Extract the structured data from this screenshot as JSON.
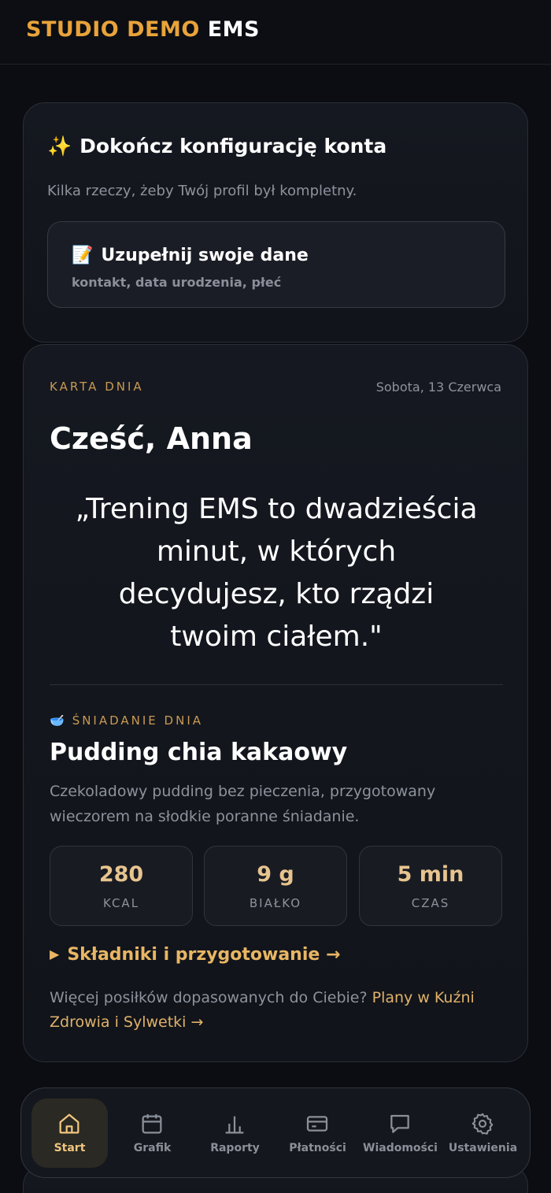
{
  "header": {
    "brand_primary": "STUDIO DEMO",
    "brand_secondary": "EMS"
  },
  "setup_card": {
    "icon": "sparkles-icon",
    "title": "Dokończ konfigurację konta",
    "subtitle": "Kilka rzeczy, żeby Twój profil był kompletny.",
    "task": {
      "icon": "memo-icon",
      "title": "Uzupełnij swoje dane",
      "subtitle": "kontakt, data urodzenia, płeć"
    }
  },
  "day_card": {
    "eyebrow": "KARTA DNIA",
    "date": "Sobota, 13 Czerwca",
    "greeting": "Cześć, Anna",
    "quote": "„Trening EMS to dwadzieścia minut, w których decydujesz, kto rządzi twoim ciałem.\"",
    "meal": {
      "icon": "bowl-icon",
      "eyebrow": "ŚNIADANIE DNIA",
      "title": "Pudding chia kakaowy",
      "description": "Czekoladowy pudding bez pieczenia, przygotowany wieczorem na słodkie poranne śniadanie.",
      "stats": [
        {
          "value": "280",
          "label": "KCAL"
        },
        {
          "value": "9 g",
          "label": "BIAŁKO"
        },
        {
          "value": "5 min",
          "label": "CZAS"
        }
      ],
      "recipe_link": "Składniki i przygotowanie →"
    },
    "more_text": "Więcej posiłków dopasowanych do Ciebie?",
    "more_link": "Plany w Kuźni Zdrowia i Sylwetki →"
  },
  "tabbar": {
    "tabs": [
      {
        "label": "Start",
        "icon": "home-icon",
        "active": true
      },
      {
        "label": "Grafik",
        "icon": "calendar-icon",
        "active": false
      },
      {
        "label": "Raporty",
        "icon": "bar-chart-icon",
        "active": false
      },
      {
        "label": "Płatności",
        "icon": "credit-card-icon",
        "active": false
      },
      {
        "label": "Wiadomości",
        "icon": "message-icon",
        "active": false
      },
      {
        "label": "Ustawienia",
        "icon": "gear-icon",
        "active": false
      }
    ]
  },
  "colors": {
    "accent": "#e8a33a",
    "background": "#0b0d12",
    "card": "#151820"
  }
}
